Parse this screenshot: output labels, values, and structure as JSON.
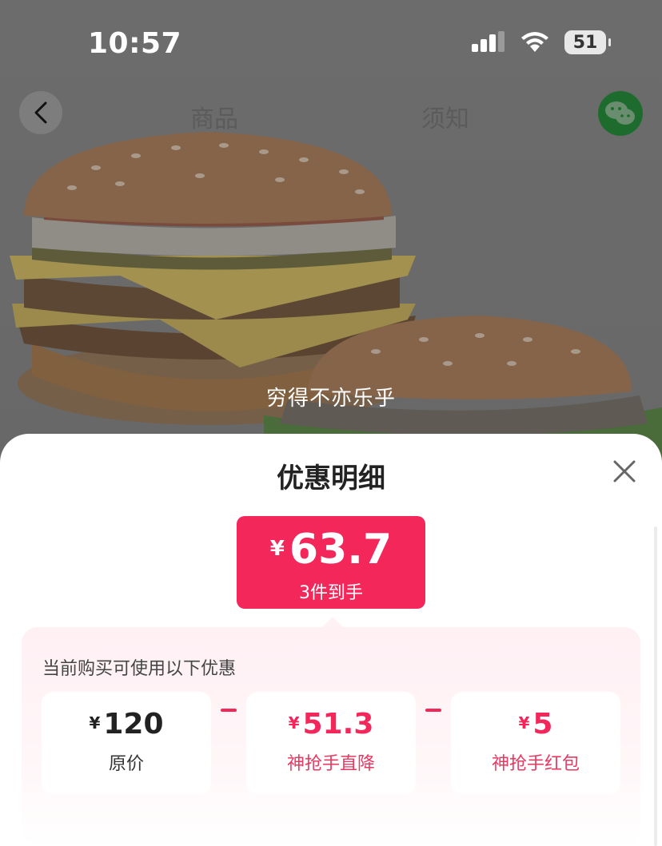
{
  "status_bar": {
    "time": "10:57",
    "battery": "51"
  },
  "nav": {
    "tab_goods": "商品",
    "tab_notice": "须知"
  },
  "hero": {
    "caption": "穷得不亦乐乎"
  },
  "sheet": {
    "title": "优惠明细",
    "final_price": {
      "currency": "¥",
      "amount": "63.7",
      "subtitle": "3件到手"
    },
    "discount_header": "当前购买可使用以下优惠",
    "items": [
      {
        "currency": "¥",
        "amount": "120",
        "label": "原价"
      },
      {
        "currency": "¥",
        "amount": "51.3",
        "label": "神抢手直降"
      },
      {
        "currency": "¥",
        "amount": "5",
        "label": "神抢手红包"
      }
    ]
  },
  "colors": {
    "accent": "#f4275a",
    "text_dark": "#222222",
    "wechat_green": "#1e6c2d"
  },
  "icons": [
    "back-arrow-icon",
    "wechat-icon",
    "close-icon",
    "signal-icon",
    "wifi-icon",
    "battery-icon"
  ]
}
